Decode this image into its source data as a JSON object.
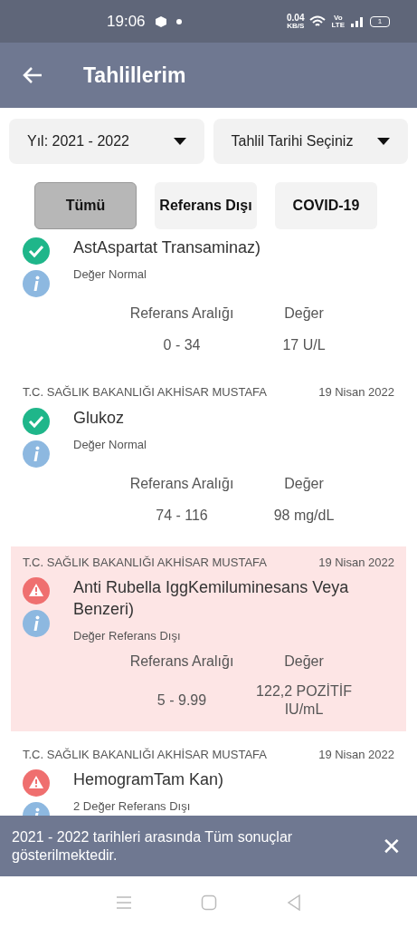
{
  "status_bar": {
    "time": "19:06",
    "net_speed": "0.04",
    "net_unit": "KB/S",
    "volte": "Vo",
    "lte": "LTE",
    "battery": "1"
  },
  "app_bar": {
    "title": "Tahlillerim"
  },
  "filters": [
    {
      "label": "Yıl: 2021 - 2022"
    },
    {
      "label": "Tahlil Tarihi Seçiniz"
    }
  ],
  "tabs": [
    {
      "label": "Tümü",
      "selected": true
    },
    {
      "label": "Referans Dışı",
      "selected": false
    },
    {
      "label": "COVID-19",
      "selected": false
    }
  ],
  "results": [
    {
      "kind": "normal",
      "highlighted": false,
      "test": "AstAspartat Transaminaz)",
      "note": "Değer Normal",
      "range_label": "Referans Aralığı",
      "value_label": "Değer",
      "range": "0 - 34",
      "value": "17 U/L"
    },
    {
      "kind": "normal",
      "highlighted": false,
      "hospital": "T.C. SAĞLIK BAKANLIĞI AKHİSAR MUSTAFA",
      "date": "19 Nisan 2022",
      "test": "Glukoz",
      "note": "Değer Normal",
      "range_label": "Referans Aralığı",
      "value_label": "Değer",
      "range": "74 - 116",
      "value": "98 mg/dL"
    },
    {
      "kind": "abnormal",
      "highlighted": true,
      "hospital": "T.C. SAĞLIK BAKANLIĞI AKHİSAR MUSTAFA",
      "date": "19 Nisan 2022",
      "test": "Anti Rubella IggKemiluminesans Veya Benzeri)",
      "note": "Değer Referans Dışı",
      "range_label": "Referans Aralığı",
      "value_label": "Değer",
      "range": "5 - 9.99",
      "value": "122,2 POZİTİF IU/mL"
    },
    {
      "kind": "abnormal",
      "highlighted": false,
      "hospital": "T.C. SAĞLIK BAKANLIĞI AKHİSAR MUSTAFA",
      "date": "19 Nisan 2022",
      "test": "HemogramTam Kan)",
      "note": "2 Değer Referans Dışı"
    }
  ],
  "snackbar": {
    "message": "2021 - 2022 tarihleri arasında Tüm sonuçlar gösterilmektedir.",
    "close": "✕"
  }
}
